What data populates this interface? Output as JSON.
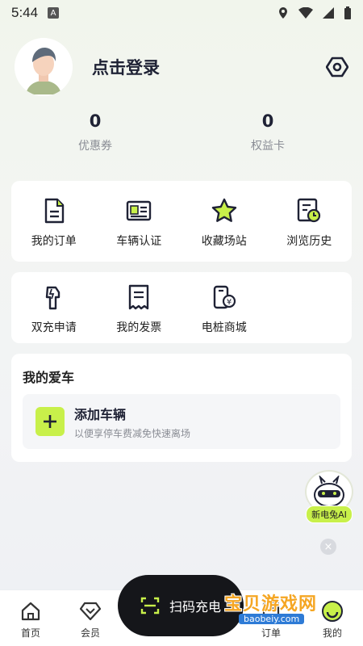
{
  "status": {
    "time": "5:44",
    "a_icon": "A"
  },
  "profile": {
    "login_text": "点击登录"
  },
  "stats": [
    {
      "value": "0",
      "label": "优惠券"
    },
    {
      "value": "0",
      "label": "权益卡"
    }
  ],
  "menu1": [
    {
      "label": "我的订单",
      "icon": "order-doc-icon"
    },
    {
      "label": "车辆认证",
      "icon": "vehicle-card-icon"
    },
    {
      "label": "收藏场站",
      "icon": "star-icon"
    },
    {
      "label": "浏览历史",
      "icon": "history-clock-icon"
    }
  ],
  "menu2": [
    {
      "label": "双充申请",
      "icon": "charger-gun-icon"
    },
    {
      "label": "我的发票",
      "icon": "invoice-icon"
    },
    {
      "label": "电桩商城",
      "icon": "pile-mall-icon"
    }
  ],
  "my_car": {
    "title": "我的爱车",
    "add_title": "添加车辆",
    "add_subtitle": "以便享停车费减免快速离场"
  },
  "ai_float": {
    "label": "新电兔AI"
  },
  "tabbar": {
    "home": "首页",
    "member": "会员",
    "scan": "扫码充电",
    "order": "订单",
    "mine": "我的"
  },
  "watermark": {
    "text": "宝贝游戏网",
    "url": "baobeiy.com"
  },
  "colors": {
    "accent": "#c8f04a",
    "dark": "#15161a"
  }
}
